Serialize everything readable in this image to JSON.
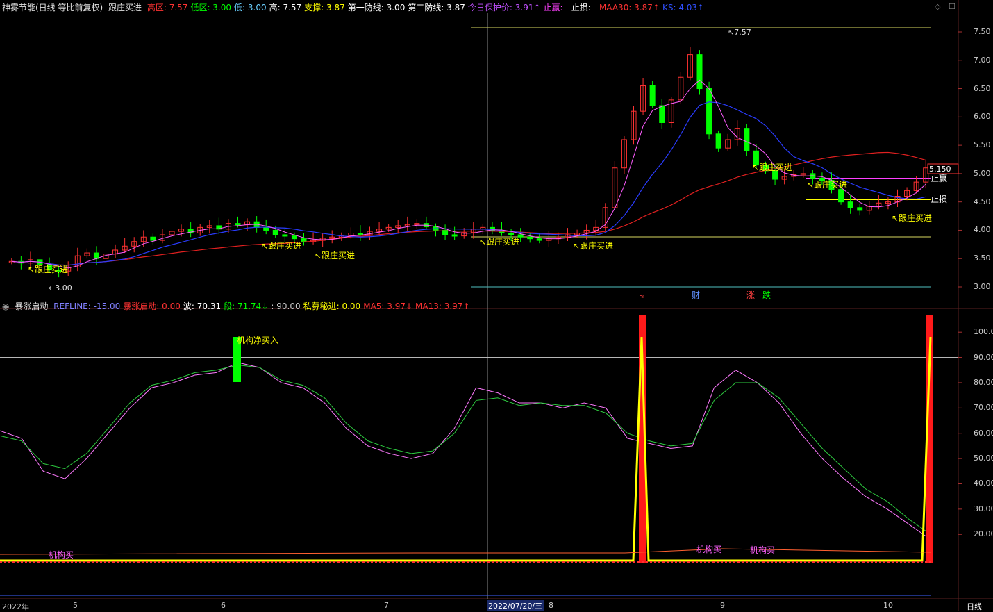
{
  "colors": {
    "bg": "#000000",
    "up": "#ff3232",
    "down": "#00ff00",
    "flag_yellow": "#ffff00",
    "ma_red": "#e02020",
    "ma_blue": "#2a3cff",
    "ma_pink": "#ff5cff",
    "text_gray": "#c8c8c8",
    "line_cyan": "#50c0c0",
    "osc_pink": "#ff7aff",
    "osc_green": "#2ecc40"
  },
  "header": {
    "stock_name": "神雾节能(日线 等比前复权)",
    "indicator_name": "跟庄买进",
    "fields": [
      {
        "label": "高区:",
        "value": "7.57",
        "color": "#ff3232"
      },
      {
        "label": "低区:",
        "value": "3.00",
        "color": "#00ff00"
      },
      {
        "label": "低:",
        "value": "3.00",
        "color": "#6ad0ff"
      },
      {
        "label": "高:",
        "value": "7.57",
        "color": "#ffffff"
      },
      {
        "label": "支撑:",
        "value": "3.87",
        "color": "#ffff00"
      },
      {
        "label": "第一防线:",
        "value": "3.00",
        "color": "#ffffff"
      },
      {
        "label": "第二防线:",
        "value": "3.87",
        "color": "#ffffff"
      },
      {
        "label": "今日保护价:",
        "value": "3.91↑",
        "color": "#c050ff"
      },
      {
        "label": "止赢:",
        "value": "-",
        "color": "#ff40ff"
      },
      {
        "label": "止损:",
        "value": "-",
        "color": "#ffffff"
      },
      {
        "label": "MAA30:",
        "value": "3.87↑",
        "color": "#ff3232"
      },
      {
        "label": "KS:",
        "value": "4.03↑",
        "color": "#3050ff"
      }
    ]
  },
  "sub_header": {
    "name": "暴涨启动",
    "fields": [
      {
        "label": "REFLINE:",
        "value": "-15.00",
        "color": "#8080ff"
      },
      {
        "label": "暴涨启动:",
        "value": "0.00",
        "color": "#ff3232"
      },
      {
        "label": "波:",
        "value": "70.31",
        "color": "#ffffff"
      },
      {
        "label": "段:",
        "value": "71.74↓",
        "color": "#00ff00"
      },
      {
        "label": ":",
        "value": "90.00",
        "color": "#c8c8c8"
      },
      {
        "label": "私募秘进:",
        "value": "0.00",
        "color": "#ffff00"
      },
      {
        "label": "MA5:",
        "value": "3.97↓",
        "color": "#ff3232"
      },
      {
        "label": "MA13:",
        "value": "3.97↑",
        "color": "#ff3232"
      }
    ]
  },
  "price_axis": [
    "7.50",
    "7.00",
    "6.50",
    "6.00",
    "5.50",
    "5.00",
    "4.50",
    "4.00",
    "3.50",
    "3.00"
  ],
  "osc_axis": [
    "100.0",
    "90.00",
    "80.00",
    "70.00",
    "60.00",
    "50.00",
    "40.00",
    "30.00",
    "20.00"
  ],
  "time_axis": {
    "labels": [
      "2022年",
      "5",
      "6",
      "7",
      "8",
      "9",
      "10"
    ],
    "cursor_date": "2022/07/20/三",
    "period": "日线"
  },
  "annotations": {
    "high_mark": "7.57",
    "low_mark": "3.00",
    "price_tag": "5.150",
    "stop_win": "止赢",
    "stop_loss": "止损",
    "buy_signal": "跟庄买进",
    "inst_net_buy": "机构净买入",
    "inst_buy": "机构买",
    "events": [
      "财",
      "涨",
      "跌"
    ]
  },
  "chart_data": {
    "type": "candlestick",
    "title": "神雾节能(日线 等比前复权)",
    "ylim": [
      3.0,
      7.57
    ],
    "support": 3.87,
    "first_defense": 3.0,
    "second_defense": 3.87,
    "maa30": 3.87,
    "ks": 4.03,
    "oscillator": {
      "ylim": [
        0,
        105
      ],
      "refline": 90,
      "series": [
        {
          "values": [
            61,
            58,
            45,
            42,
            50,
            60,
            70,
            78,
            80,
            83,
            84,
            88,
            86,
            80,
            78,
            72,
            62,
            55,
            52,
            50,
            52,
            62,
            78,
            76,
            72,
            72,
            70,
            72,
            70,
            58,
            56,
            54,
            55,
            78,
            85,
            80,
            72,
            60,
            50,
            42,
            35,
            30,
            24,
            18
          ]
        },
        {
          "values": [
            59,
            57,
            48,
            46,
            52,
            62,
            72,
            79,
            81,
            84,
            85,
            87,
            86,
            81,
            79,
            74,
            64,
            57,
            54,
            52,
            53,
            60,
            73,
            74,
            71,
            72,
            71,
            71,
            68,
            60,
            57,
            55,
            56,
            73,
            80,
            80,
            74,
            64,
            54,
            46,
            38,
            33,
            26,
            20
          ]
        }
      ]
    }
  }
}
